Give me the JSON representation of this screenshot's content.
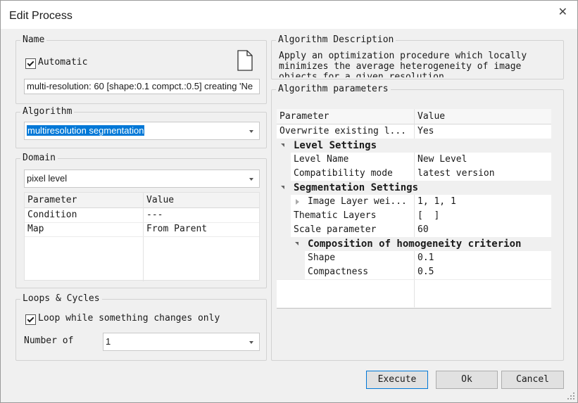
{
  "window": {
    "title": "Edit Process"
  },
  "name_group": {
    "label": "Name",
    "automatic_label": "Automatic",
    "automatic_checked": true,
    "name_value": "multi-resolution: 60 [shape:0.1 compct.:0.5] creating 'Ne"
  },
  "algorithm_group": {
    "label": "Algorithm",
    "value": "multiresolution segmentation"
  },
  "domain_group": {
    "label": "Domain",
    "value": "pixel level",
    "columns": [
      "Parameter",
      "Value"
    ],
    "rows": [
      {
        "param": "Condition",
        "value": "---"
      },
      {
        "param": "Map",
        "value": "From Parent"
      }
    ]
  },
  "loops_group": {
    "label": "Loops & Cycles",
    "loop_label": "Loop while something changes only",
    "loop_checked": true,
    "number_label": "Number of",
    "number_value": "1"
  },
  "description_group": {
    "label": "Algorithm Description",
    "lines": [
      "Apply an optimization procedure which locally",
      "minimizes the average heterogeneity of image",
      "objects for a given resolution"
    ]
  },
  "params_group": {
    "label": "Algorithm parameters",
    "columns": [
      "Parameter",
      "Value"
    ],
    "rows": [
      {
        "param": "Overwrite existing l...",
        "value": "Yes"
      },
      {
        "param": "Level Settings",
        "value": ""
      },
      {
        "param": "Level Name",
        "value": "New Level"
      },
      {
        "param": "Compatibility mode",
        "value": "latest version"
      },
      {
        "param": "Segmentation Settings",
        "value": ""
      },
      {
        "param": "Image Layer wei...",
        "value": "1, 1, 1"
      },
      {
        "param": "Thematic Layers",
        "value": "[  ]"
      },
      {
        "param": "Scale parameter",
        "value": "60"
      },
      {
        "param": "Composition of homogeneity criterion",
        "value": ""
      },
      {
        "param": "Shape",
        "value": "0.1"
      },
      {
        "param": "Compactness",
        "value": "0.5"
      }
    ]
  },
  "buttons": {
    "execute": "Execute",
    "ok": "Ok",
    "cancel": "Cancel"
  }
}
